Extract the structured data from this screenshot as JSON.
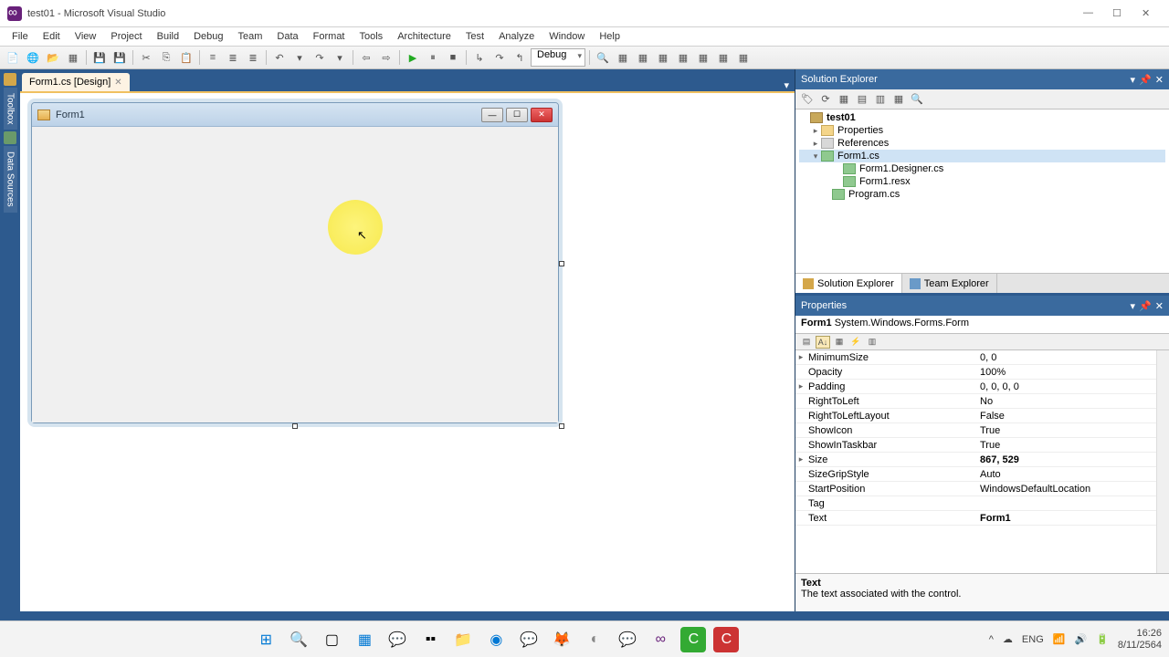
{
  "title": "test01 - Microsoft Visual Studio",
  "menus": [
    "File",
    "Edit",
    "View",
    "Project",
    "Build",
    "Debug",
    "Team",
    "Data",
    "Format",
    "Tools",
    "Architecture",
    "Test",
    "Analyze",
    "Window",
    "Help"
  ],
  "toolbar": {
    "config": "Debug"
  },
  "left_tabs": [
    "Toolbox",
    "Data Sources"
  ],
  "doc_tab": {
    "label": "Form1.cs [Design]",
    "close": "✕"
  },
  "form": {
    "caption": "Form1"
  },
  "sol_explorer": {
    "title": "Solution Explorer",
    "nodes": {
      "project": "test01",
      "properties": "Properties",
      "references": "References",
      "form1": "Form1.cs",
      "form1_designer": "Form1.Designer.cs",
      "form1_resx": "Form1.resx",
      "program": "Program.cs"
    },
    "tabs": {
      "sol": "Solution Explorer",
      "team": "Team Explorer"
    }
  },
  "props": {
    "title": "Properties",
    "object": "Form1",
    "object_type": "System.Windows.Forms.Form",
    "rows": [
      {
        "exp": "▸",
        "name": "MinimumSize",
        "val": "0, 0"
      },
      {
        "exp": "",
        "name": "Opacity",
        "val": "100%"
      },
      {
        "exp": "▸",
        "name": "Padding",
        "val": "0, 0, 0, 0"
      },
      {
        "exp": "",
        "name": "RightToLeft",
        "val": "No"
      },
      {
        "exp": "",
        "name": "RightToLeftLayout",
        "val": "False"
      },
      {
        "exp": "",
        "name": "ShowIcon",
        "val": "True"
      },
      {
        "exp": "",
        "name": "ShowInTaskbar",
        "val": "True"
      },
      {
        "exp": "▸",
        "name": "Size",
        "val": "867, 529",
        "bold": true
      },
      {
        "exp": "",
        "name": "SizeGripStyle",
        "val": "Auto"
      },
      {
        "exp": "",
        "name": "StartPosition",
        "val": "WindowsDefaultLocation"
      },
      {
        "exp": "",
        "name": "Tag",
        "val": ""
      },
      {
        "exp": "",
        "name": "Text",
        "val": "Form1",
        "bold": true
      }
    ],
    "desc_name": "Text",
    "desc_text": "The text associated with the control."
  },
  "tray": {
    "lang": "ENG",
    "time": "16:26",
    "date": "8/11/2564"
  }
}
